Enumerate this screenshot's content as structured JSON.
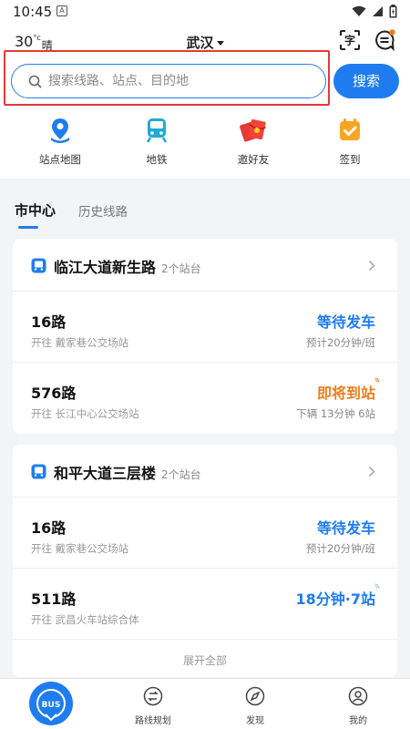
{
  "status_bar": {
    "time": "10:45",
    "notif_letter": "A"
  },
  "header": {
    "temperature": "30",
    "degree_unit": "°c",
    "weather_condition": "晴",
    "city": "武汉",
    "ocr_icon_label": "字"
  },
  "search": {
    "placeholder": "搜索线路、站点、目的地",
    "button_label": "搜索"
  },
  "quick_nav": [
    {
      "label": "站点地图",
      "icon": "map-pin-icon"
    },
    {
      "label": "地铁",
      "icon": "subway-icon"
    },
    {
      "label": "邀好友",
      "icon": "red-envelope-icon"
    },
    {
      "label": "签到",
      "icon": "checkin-icon"
    }
  ],
  "tabs": {
    "active": "市中心",
    "inactive": "历史线路"
  },
  "stops": [
    {
      "name": "临江大道新生路",
      "count": "2个站台",
      "routes": [
        {
          "name": "16路",
          "destination": "开往 戴家巷公交场站",
          "status": "等待发车",
          "sub": "预计20分钟/班"
        },
        {
          "name": "576路",
          "destination": "开往 长江中心公交场站",
          "status": "即将到站",
          "sub": "下辆  13分钟 6站"
        }
      ]
    },
    {
      "name": "和平大道三层楼",
      "count": "2个站台",
      "routes": [
        {
          "name": "16路",
          "destination": "开往 戴家巷公交场站",
          "status": "等待发车",
          "sub": "预计20分钟/班"
        },
        {
          "name": "511路",
          "destination": "开往 武昌火车站综合体",
          "status": "18分钟·7站",
          "sub": ""
        }
      ],
      "expand_label": "展开全部"
    }
  ],
  "bottom_nav": [
    {
      "label": "BUS",
      "icon": "bus-home-icon"
    },
    {
      "label": "路线规划",
      "icon": "route-plan-icon"
    },
    {
      "label": "发现",
      "icon": "compass-icon"
    },
    {
      "label": "我的",
      "icon": "user-icon"
    }
  ],
  "colors": {
    "accent": "#1f7cf0",
    "arriving": "#f07d1a",
    "highlight": "#e53935"
  }
}
